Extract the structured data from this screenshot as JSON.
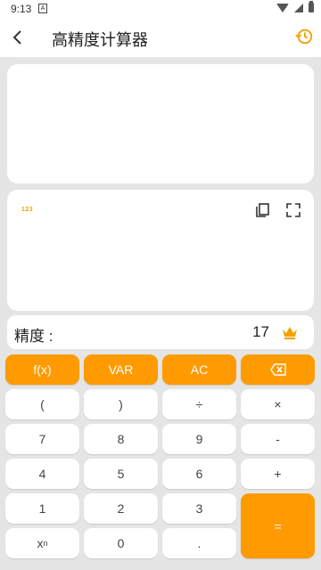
{
  "status": {
    "time": "9:13",
    "notif": "A"
  },
  "header": {
    "title": "高精度计算器"
  },
  "precision": {
    "label": "精度 :",
    "value": "17"
  },
  "result": {
    "badge": "123"
  },
  "keypad": {
    "row1": [
      "f(x)",
      "VAR",
      "AC"
    ],
    "row2": [
      "(",
      ")",
      "÷",
      "×"
    ],
    "row3": [
      "7",
      "8",
      "9",
      "-"
    ],
    "row4": [
      "4",
      "5",
      "6",
      "+"
    ],
    "row5": [
      "1",
      "2",
      "3"
    ],
    "row6": [
      "0",
      "."
    ],
    "power_base": "x",
    "power_exp": "n",
    "equals": "="
  },
  "colors": {
    "accent": "#ff9b00",
    "background": "#e5e5e5",
    "card": "#ffffff"
  },
  "icons": [
    "back-arrow",
    "history-icon",
    "copy-icon",
    "expand-icon",
    "crown-icon",
    "backspace-icon"
  ]
}
